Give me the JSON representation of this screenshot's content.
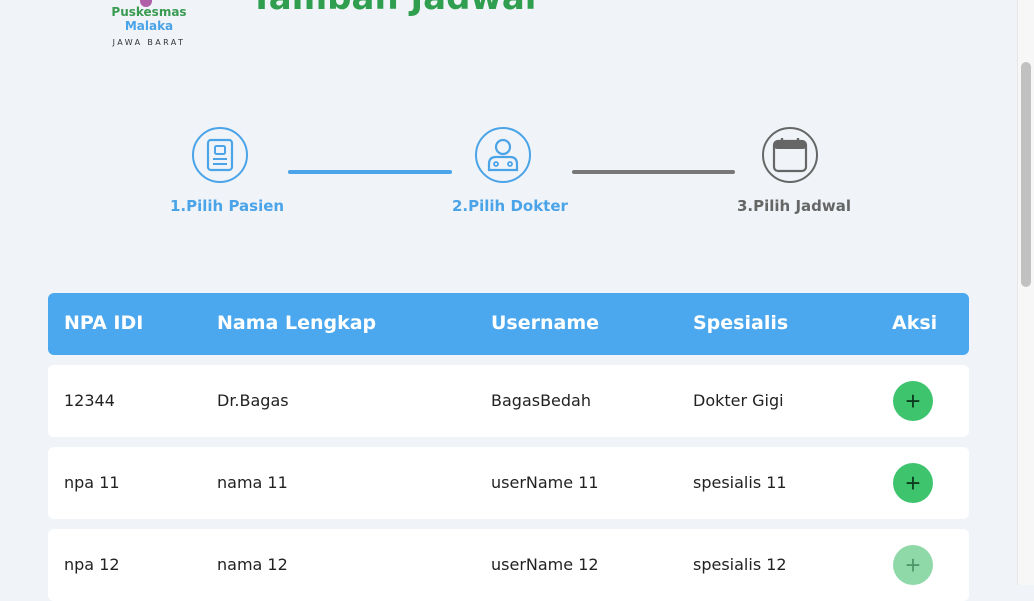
{
  "brand": {
    "name_part1": "Puskesmas",
    "name_part2": "Malaka",
    "region": "JAWA BARAT"
  },
  "page": {
    "title": "Tambah Jadwal"
  },
  "steps": [
    {
      "label": "1.Pilih Pasien",
      "icon": "id-card-icon",
      "state": "done"
    },
    {
      "label": "2.Pilih Dokter",
      "icon": "doctor-icon",
      "state": "active"
    },
    {
      "label": "3.Pilih Jadwal",
      "icon": "calendar-icon",
      "state": "pending"
    }
  ],
  "colors": {
    "accent": "#4ba3e8",
    "brand_green": "#2f9e4e",
    "add_button": "#3fc46e",
    "inactive": "#666666"
  },
  "table": {
    "headers": {
      "npa": "NPA IDI",
      "nama": "Nama Lengkap",
      "username": "Username",
      "spesialis": "Spesialis",
      "aksi": "Aksi"
    },
    "rows": [
      {
        "npa": "12344",
        "nama": "Dr.Bagas",
        "username": "BagasBedah",
        "spesialis": "Dokter Gigi",
        "action_icon": "plus-icon"
      },
      {
        "npa": "npa 11",
        "nama": "nama 11",
        "username": "userName 11",
        "spesialis": "spesialis 11",
        "action_icon": "plus-icon"
      },
      {
        "npa": "npa 12",
        "nama": "nama 12",
        "username": "userName 12",
        "spesialis": "spesialis 12",
        "action_icon": "plus-icon"
      }
    ],
    "add_symbol": "+"
  }
}
